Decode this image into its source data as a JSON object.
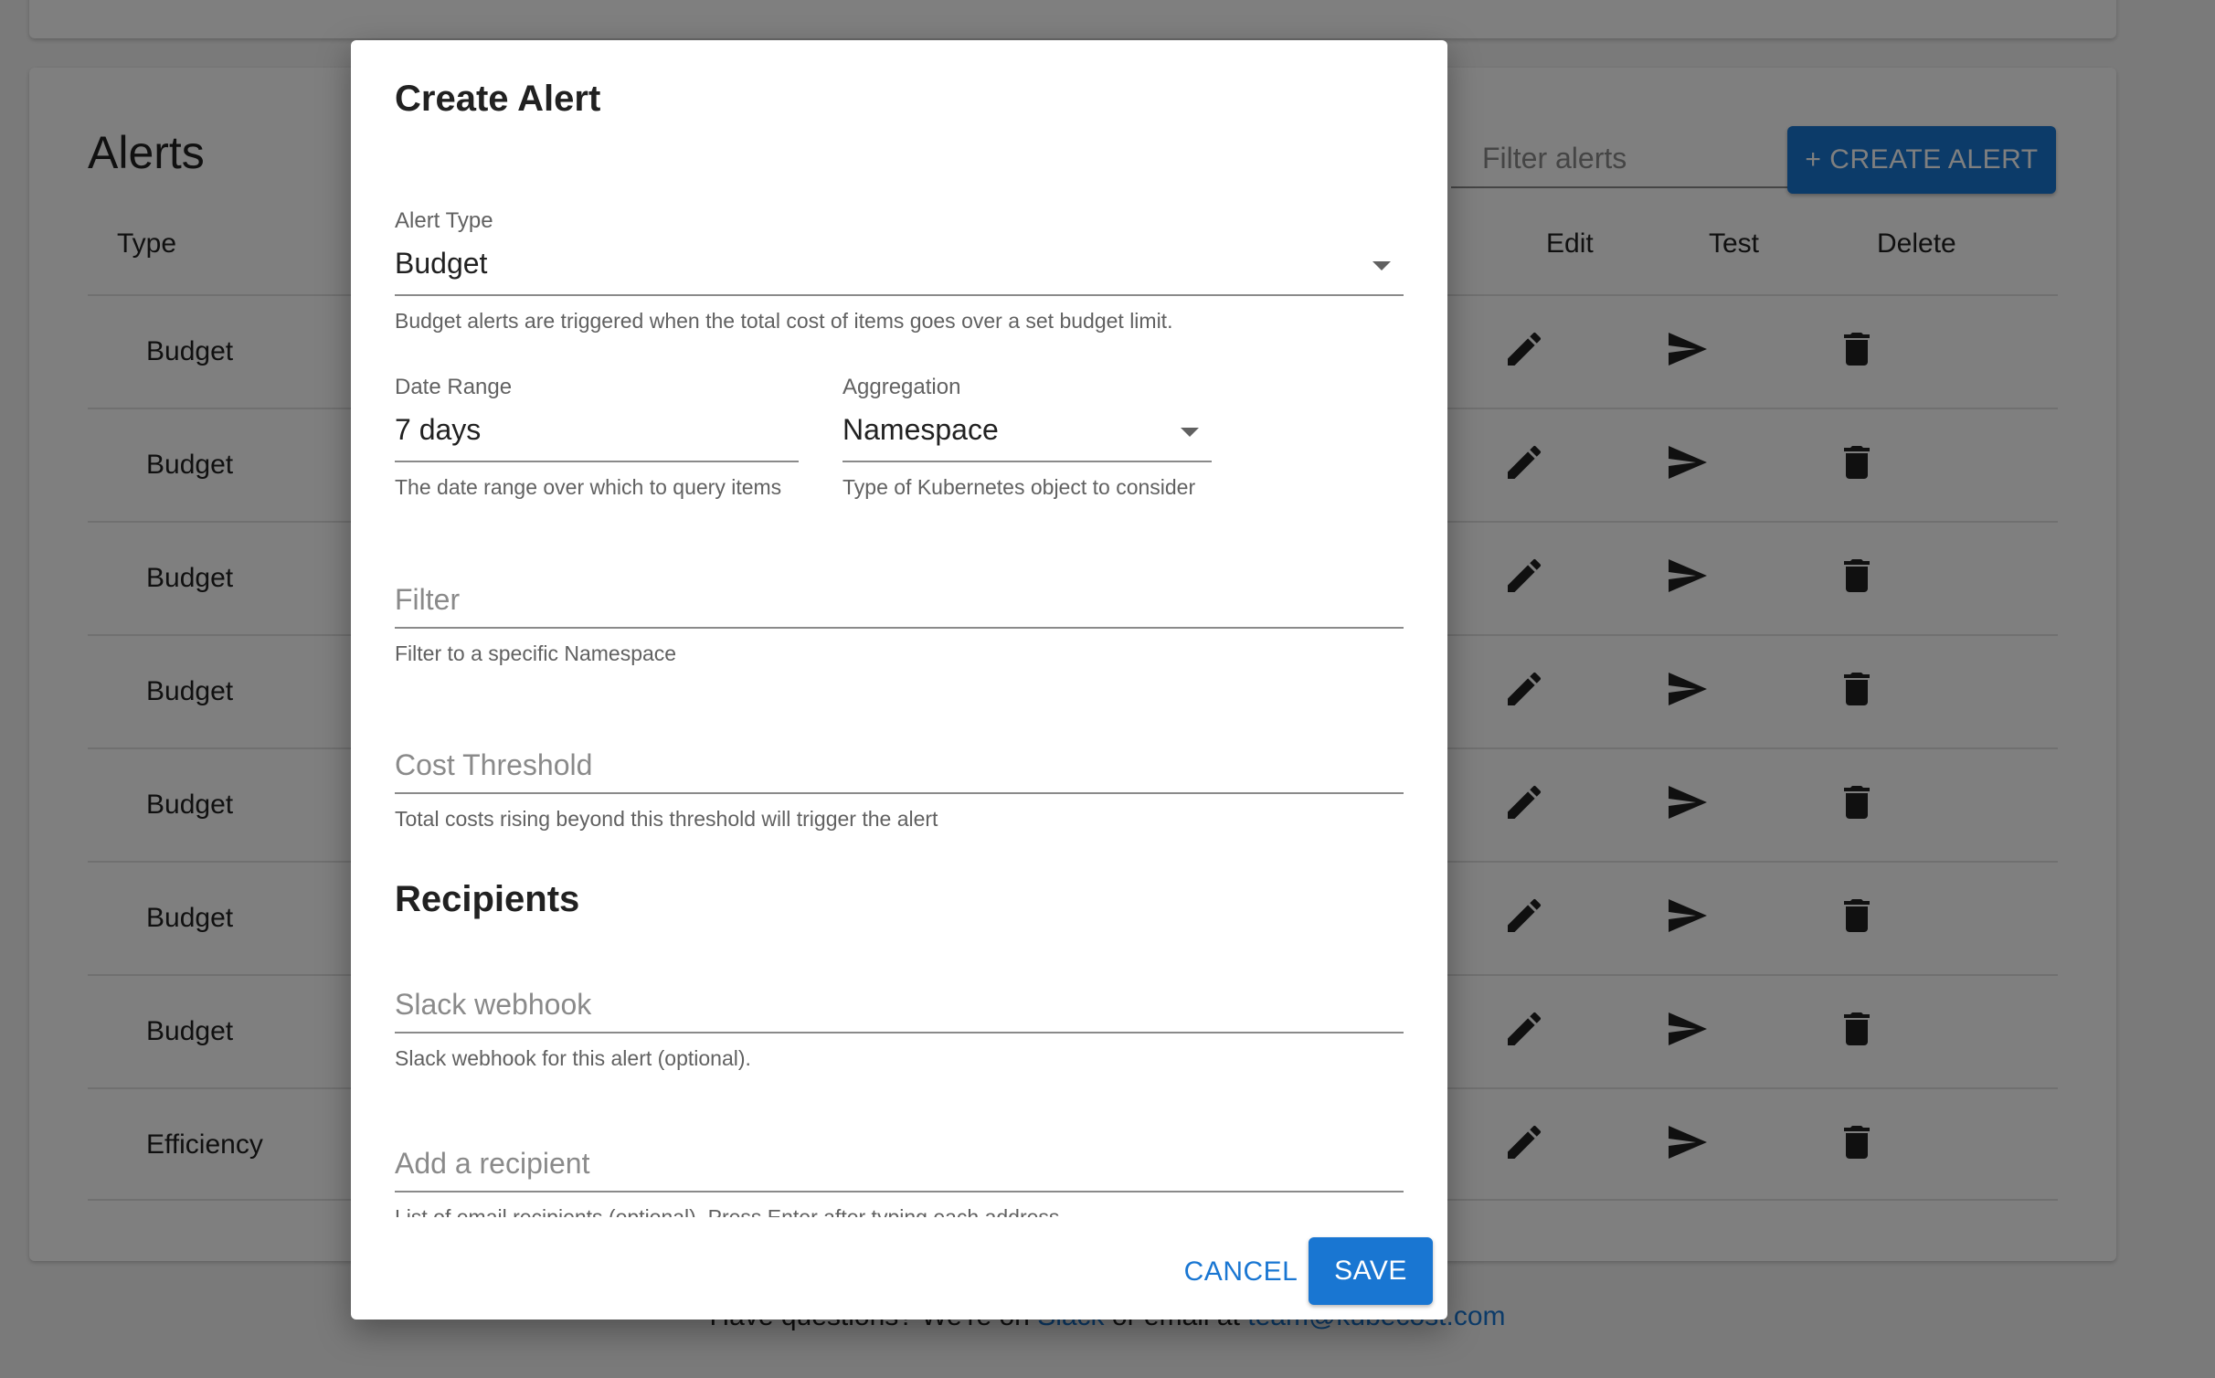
{
  "page": {
    "title": "Alerts",
    "filter_placeholder": "Filter alerts",
    "create_button": "+ CREATE ALERT",
    "columns": {
      "type": "Type",
      "edit": "Edit",
      "test": "Test",
      "delete": "Delete"
    },
    "rows": [
      {
        "type": "Budget"
      },
      {
        "type": "Budget"
      },
      {
        "type": "Budget"
      },
      {
        "type": "Budget"
      },
      {
        "type": "Budget"
      },
      {
        "type": "Budget"
      },
      {
        "type": "Budget"
      },
      {
        "type": "Efficiency"
      }
    ],
    "row_icons": {
      "edit": "pencil-icon",
      "test": "send-icon",
      "delete": "trash-icon"
    },
    "footer": {
      "text_before": "Have questions? We're on ",
      "slack_link": "Slack",
      "text_middle": " or email at ",
      "email_link": "team@kubecost.com"
    }
  },
  "dialog": {
    "title": "Create Alert",
    "alert_type": {
      "label": "Alert Type",
      "value": "Budget",
      "helper": "Budget alerts are triggered when the total cost of items goes over a set budget limit."
    },
    "date_range": {
      "label": "Date Range",
      "value": "7 days",
      "helper": "The date range over which to query items"
    },
    "aggregation": {
      "label": "Aggregation",
      "value": "Namespace",
      "helper": "Type of Kubernetes object to consider"
    },
    "filter": {
      "placeholder": "Filter",
      "helper": "Filter to a specific Namespace"
    },
    "cost_threshold": {
      "placeholder": "Cost Threshold",
      "helper": "Total costs rising beyond this threshold will trigger the alert"
    },
    "recipients_title": "Recipients",
    "slack_webhook": {
      "placeholder": "Slack webhook",
      "helper": "Slack webhook for this alert (optional)."
    },
    "add_recipient": {
      "placeholder": "Add a recipient",
      "helper": "List of email recipients (optional). Press Enter after typing each address."
    },
    "cancel_button": "CANCEL",
    "save_button": "SAVE"
  },
  "colors": {
    "primary": "#1976d2",
    "backdrop": "rgba(0,0,0,0.5)",
    "text": "#212121",
    "helper_text": "#616161"
  }
}
